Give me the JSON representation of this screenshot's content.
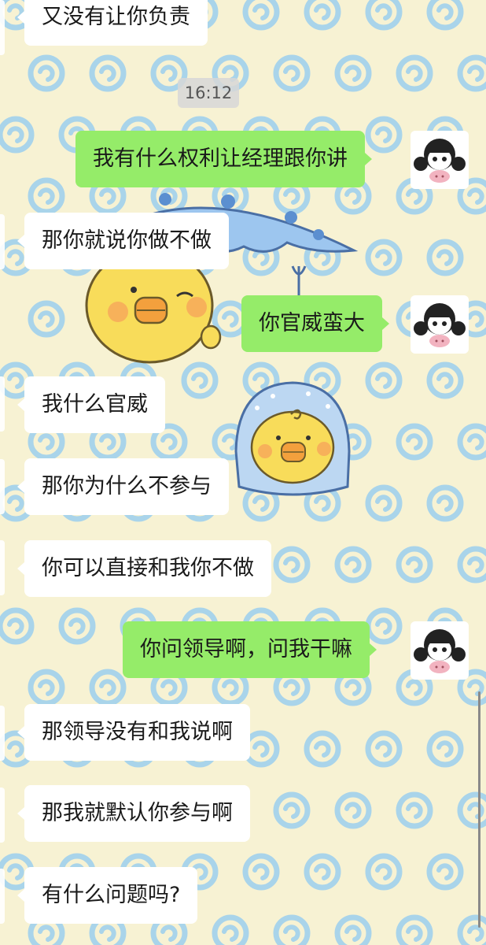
{
  "chat": {
    "timestamp": "16:12",
    "messages": [
      {
        "side": "left",
        "text": "又没有让你负责"
      },
      {
        "side": "right",
        "text": "我有什么权利让经理跟你讲"
      },
      {
        "side": "left",
        "text": "那你就说你做不做"
      },
      {
        "side": "right",
        "text": "你官威蛮大"
      },
      {
        "side": "left",
        "text": "我什么官威"
      },
      {
        "side": "left",
        "text": "那你为什么不参与"
      },
      {
        "side": "left",
        "text": "你可以直接和我你不做"
      },
      {
        "side": "right",
        "text": "你问领导啊，问我干嘛"
      },
      {
        "side": "left",
        "text": "那领导没有和我说啊"
      },
      {
        "side": "left",
        "text": "那我就默认你参与啊"
      },
      {
        "side": "left",
        "text": "有什么问题吗?"
      }
    ]
  },
  "avatar_icon": "girl-with-pig-avatar-icon",
  "background_icons": [
    "swirl-pattern",
    "chick-with-umbrella-sticker",
    "chick-in-raincoat-sticker"
  ],
  "colors": {
    "background": "#f7f2d3",
    "swirl": "#a9d4ea",
    "incoming_bubble": "#ffffff",
    "outgoing_bubble": "#95ec69",
    "chick_yellow": "#f8dc5a",
    "umbrella_blue": "#9dc6ef"
  }
}
